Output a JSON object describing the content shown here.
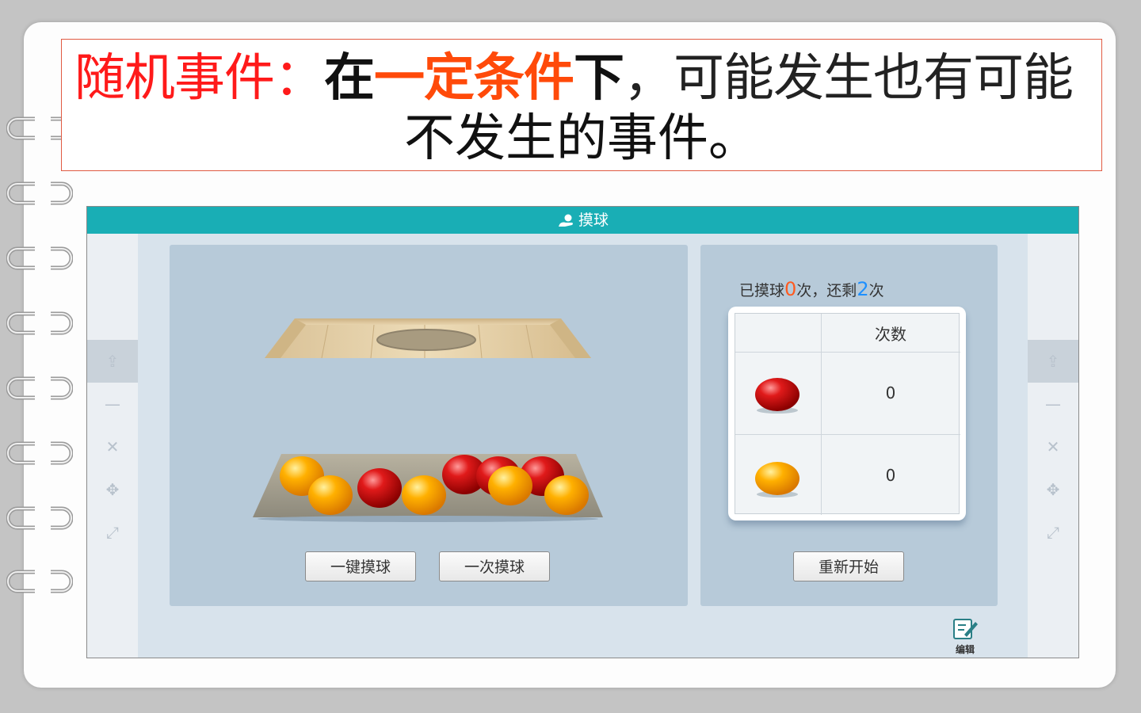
{
  "title": {
    "term": "随机事件：",
    "part_zai": "在",
    "condition": "一定条件",
    "part_xia": "下",
    "rest_line1": "，可能发生也有可能",
    "line2": "不发生的事件。"
  },
  "sim": {
    "header_title": "摸球",
    "header_icon": "hand-ball-icon",
    "status": {
      "prefix": "已摸球",
      "drawn": "0",
      "middle": "次，还剩",
      "remaining": "2",
      "suffix": "次"
    },
    "table": {
      "header_count": "次数",
      "rows": [
        {
          "ball": "red-ball-icon",
          "count": "0"
        },
        {
          "ball": "yellow-ball-icon",
          "count": "0"
        }
      ]
    },
    "buttons": {
      "draw_all": "一键摸球",
      "draw_once": "一次摸球",
      "restart": "重新开始"
    },
    "edit_label": "编辑",
    "side_tools": [
      "share-icon",
      "minimize-icon",
      "close-icon",
      "move-icon",
      "fullscreen-icon"
    ],
    "colors": {
      "header": "#19aeb5",
      "red_ball": "#d40f0f",
      "yellow_ball": "#ffaa00"
    }
  }
}
